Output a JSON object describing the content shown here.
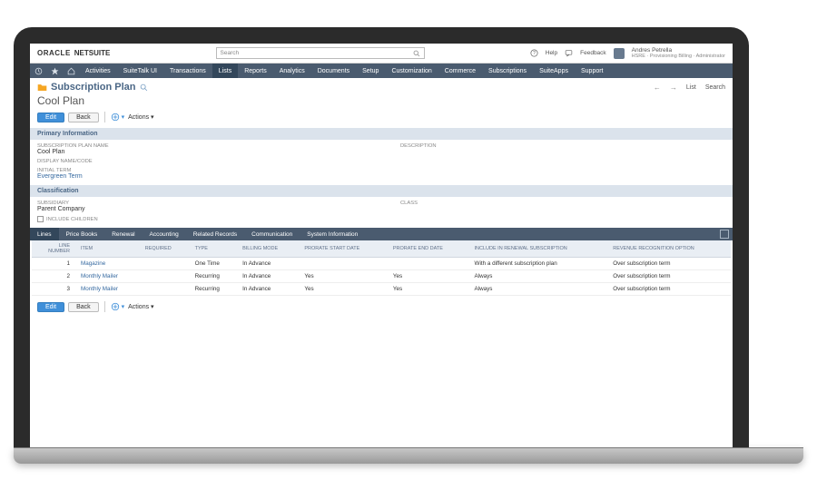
{
  "brand": {
    "oracle": "ORACLE",
    "netsuite": "NETSUITE"
  },
  "search": {
    "placeholder": "Search"
  },
  "help": {
    "label": "Help"
  },
  "feedback": {
    "label": "Feedback"
  },
  "user": {
    "name": "Andres Petrella",
    "sub": "HSRE · Provisioning Billing · Administrator"
  },
  "menu": {
    "items": [
      "Activities",
      "SuiteTalk UI",
      "Transactions",
      "Lists",
      "Reports",
      "Analytics",
      "Documents",
      "Setup",
      "Customization",
      "Commerce",
      "Subscriptions",
      "SuiteApps",
      "Support"
    ],
    "active_index": 3
  },
  "page": {
    "title": "Subscription Plan",
    "subtitle": "Cool Plan",
    "nav": {
      "list": "List",
      "search": "Search"
    }
  },
  "buttons": {
    "edit": "Edit",
    "back": "Back",
    "actions": "Actions"
  },
  "sections": {
    "primary": {
      "header": "Primary Information",
      "fields": {
        "plan_name_label": "SUBSCRIPTION PLAN NAME",
        "plan_name_value": "Cool Plan",
        "display_name_label": "DISPLAY NAME/CODE",
        "initial_term_label": "INITIAL TERM",
        "initial_term_value": "Evergreen Term",
        "description_label": "DESCRIPTION"
      }
    },
    "classification": {
      "header": "Classification",
      "fields": {
        "subsidiary_label": "SUBSIDIARY",
        "subsidiary_value": "Parent Company",
        "include_children_label": "INCLUDE CHILDREN",
        "class_label": "CLASS"
      }
    }
  },
  "tabs": [
    "Lines",
    "Price Books",
    "Renewal",
    "Accounting",
    "Related Records",
    "Communication",
    "System Information"
  ],
  "table": {
    "columns": [
      "LINE NUMBER",
      "ITEM",
      "REQUIRED",
      "TYPE",
      "BILLING MODE",
      "PRORATE START DATE",
      "PRORATE END DATE",
      "INCLUDE IN RENEWAL SUBSCRIPTION",
      "REVENUE RECOGNITION OPTION"
    ],
    "rows": [
      {
        "num": "1",
        "item": "Magazine",
        "required": "",
        "type": "One Time",
        "billing": "In Advance",
        "pstart": "",
        "pend": "",
        "renewal": "With a different subscription plan",
        "rev": "Over subscription term"
      },
      {
        "num": "2",
        "item": "Monthly Mailer",
        "required": "",
        "type": "Recurring",
        "billing": "In Advance",
        "pstart": "Yes",
        "pend": "Yes",
        "renewal": "Always",
        "rev": "Over subscription term"
      },
      {
        "num": "3",
        "item": "Monthly Mailer",
        "required": "",
        "type": "Recurring",
        "billing": "In Advance",
        "pstart": "Yes",
        "pend": "Yes",
        "renewal": "Always",
        "rev": "Over subscription term"
      }
    ]
  }
}
